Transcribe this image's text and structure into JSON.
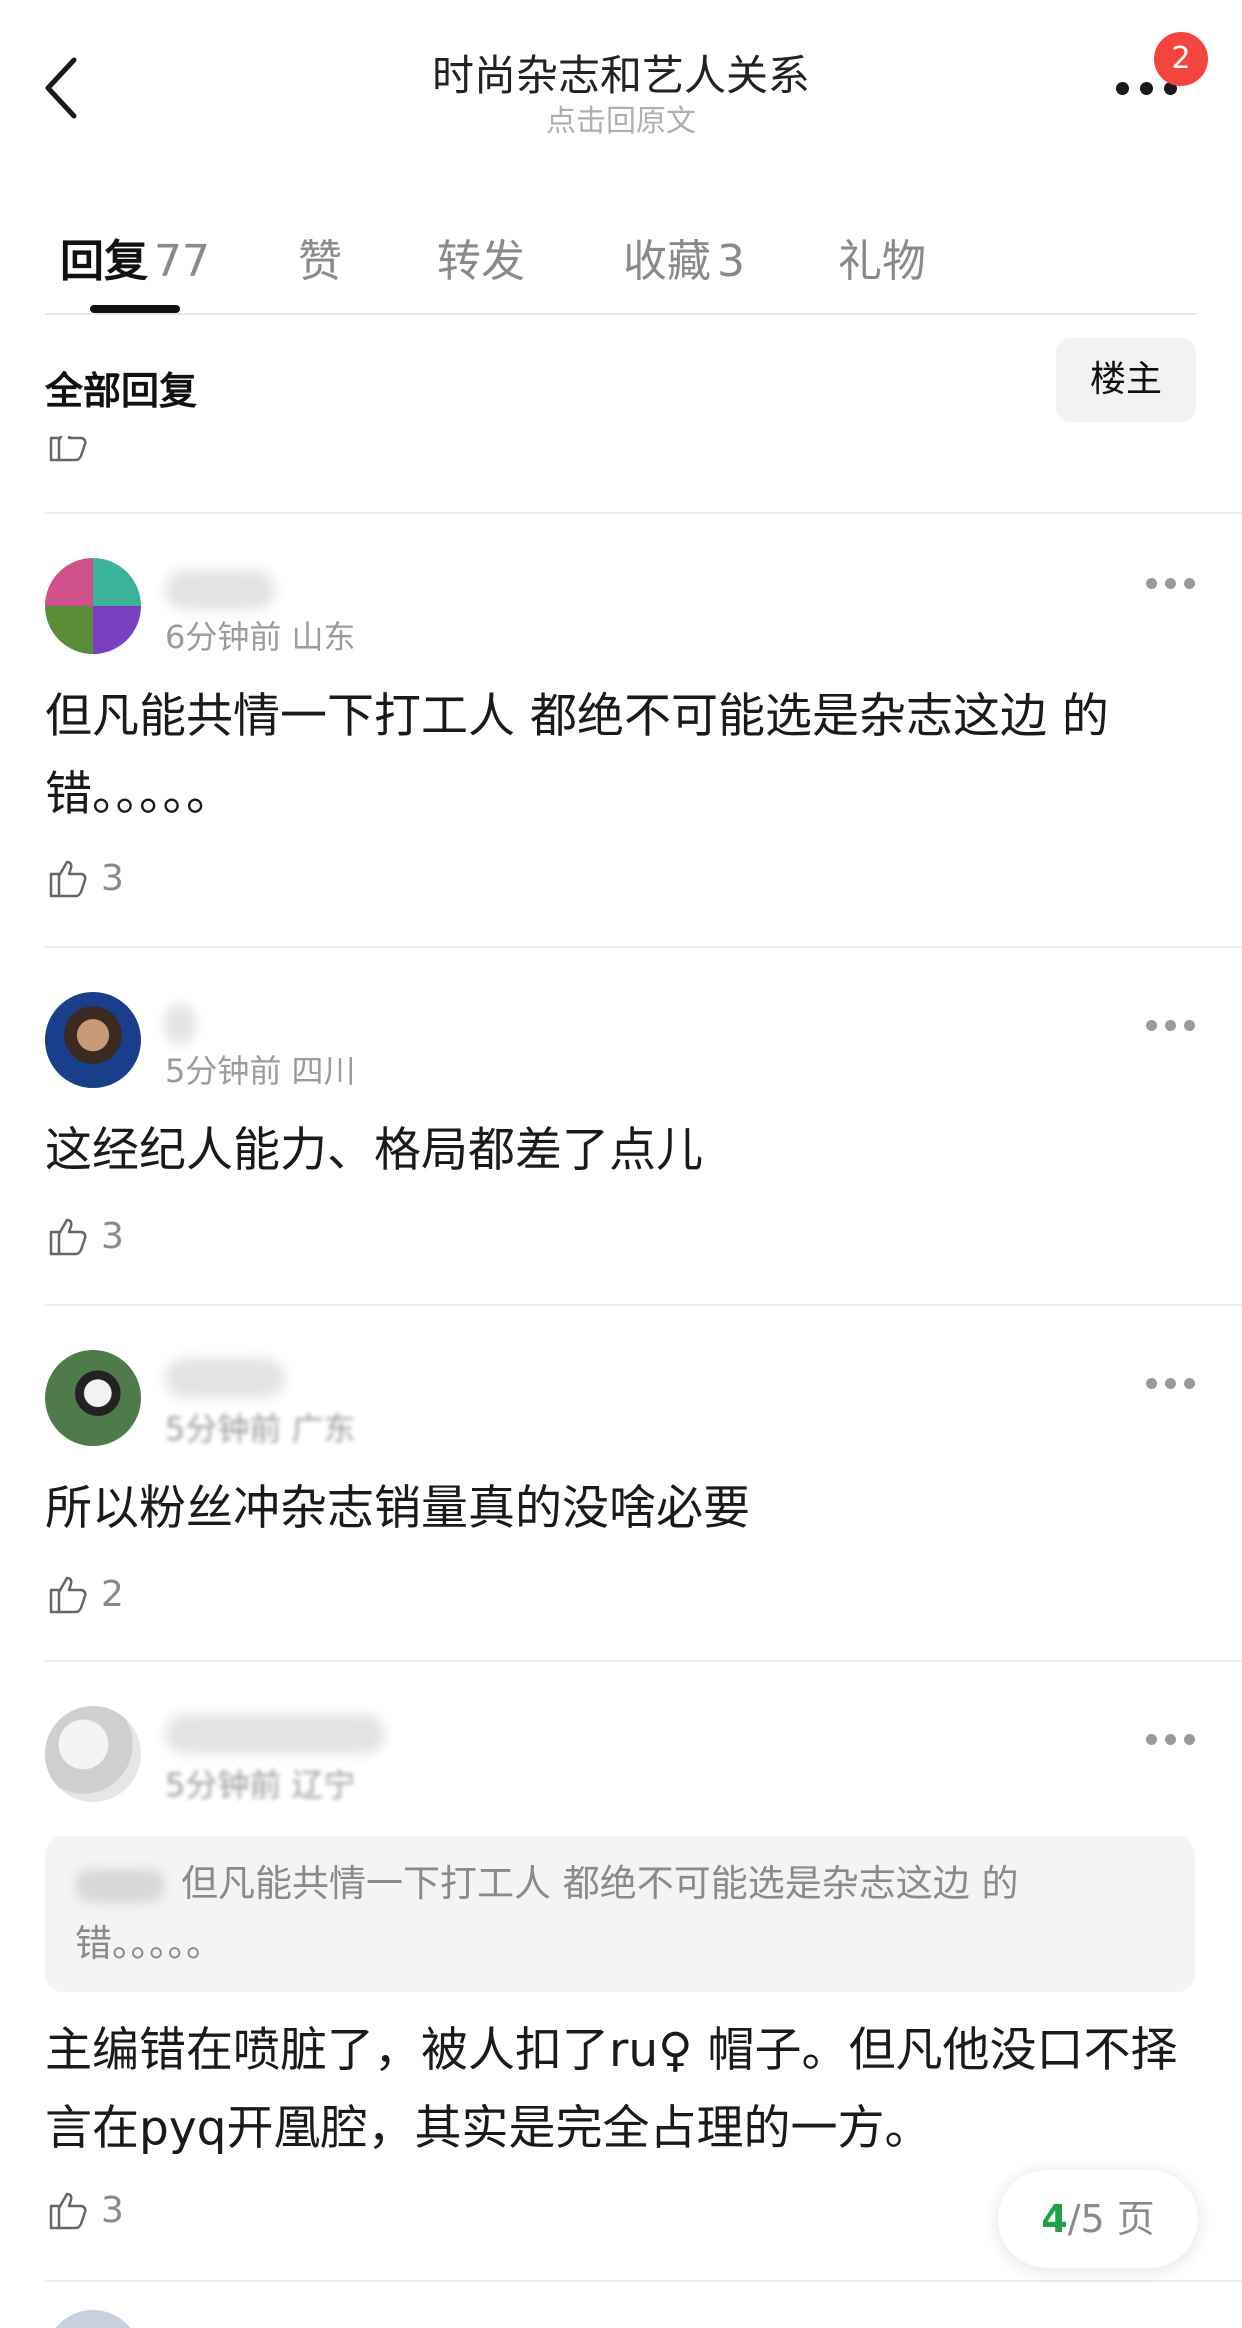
{
  "header": {
    "title": "时尚杂志和艺人关系",
    "subtitle": "点击回原文",
    "badge_count": "2",
    "back_icon": "chevron-left-icon",
    "more_icon": "more-horizontal-icon"
  },
  "tabs": [
    {
      "label": "回复",
      "count": "77",
      "active": true
    },
    {
      "label": "赞",
      "count": ""
    },
    {
      "label": "转发",
      "count": ""
    },
    {
      "label": "收藏",
      "count": "3"
    },
    {
      "label": "礼物",
      "count": ""
    }
  ],
  "filter": {
    "label": "全部回复",
    "owner_button": "楼主"
  },
  "comments": [
    {
      "meta": "6分钟前 山东",
      "text": "但凡能共情一下打工人 都绝不可能选是杂志这边 的错。。。。。",
      "likes": "3"
    },
    {
      "meta": "5分钟前 四川",
      "text": "这经纪人能力、格局都差了点儿",
      "likes": "3"
    },
    {
      "meta": "5分钟前 广东",
      "text": "所以粉丝冲杂志销量真的没啥必要",
      "likes": "2"
    },
    {
      "meta": "5分钟前 辽宁",
      "quote": "但凡能共情一下打工人 都绝不可能选是杂志这边 的错。。。。。",
      "text": "主编错在喷脏了，被人扣了ru♀ 帽子。但凡他没口不择言在pyq开凰腔，其实是完全占理的一方。",
      "likes": "3"
    }
  ],
  "pagination": {
    "current": "4",
    "total": "/5 页"
  },
  "colors": {
    "accent_green": "#1fa34a",
    "badge_red": "#f2453d"
  }
}
